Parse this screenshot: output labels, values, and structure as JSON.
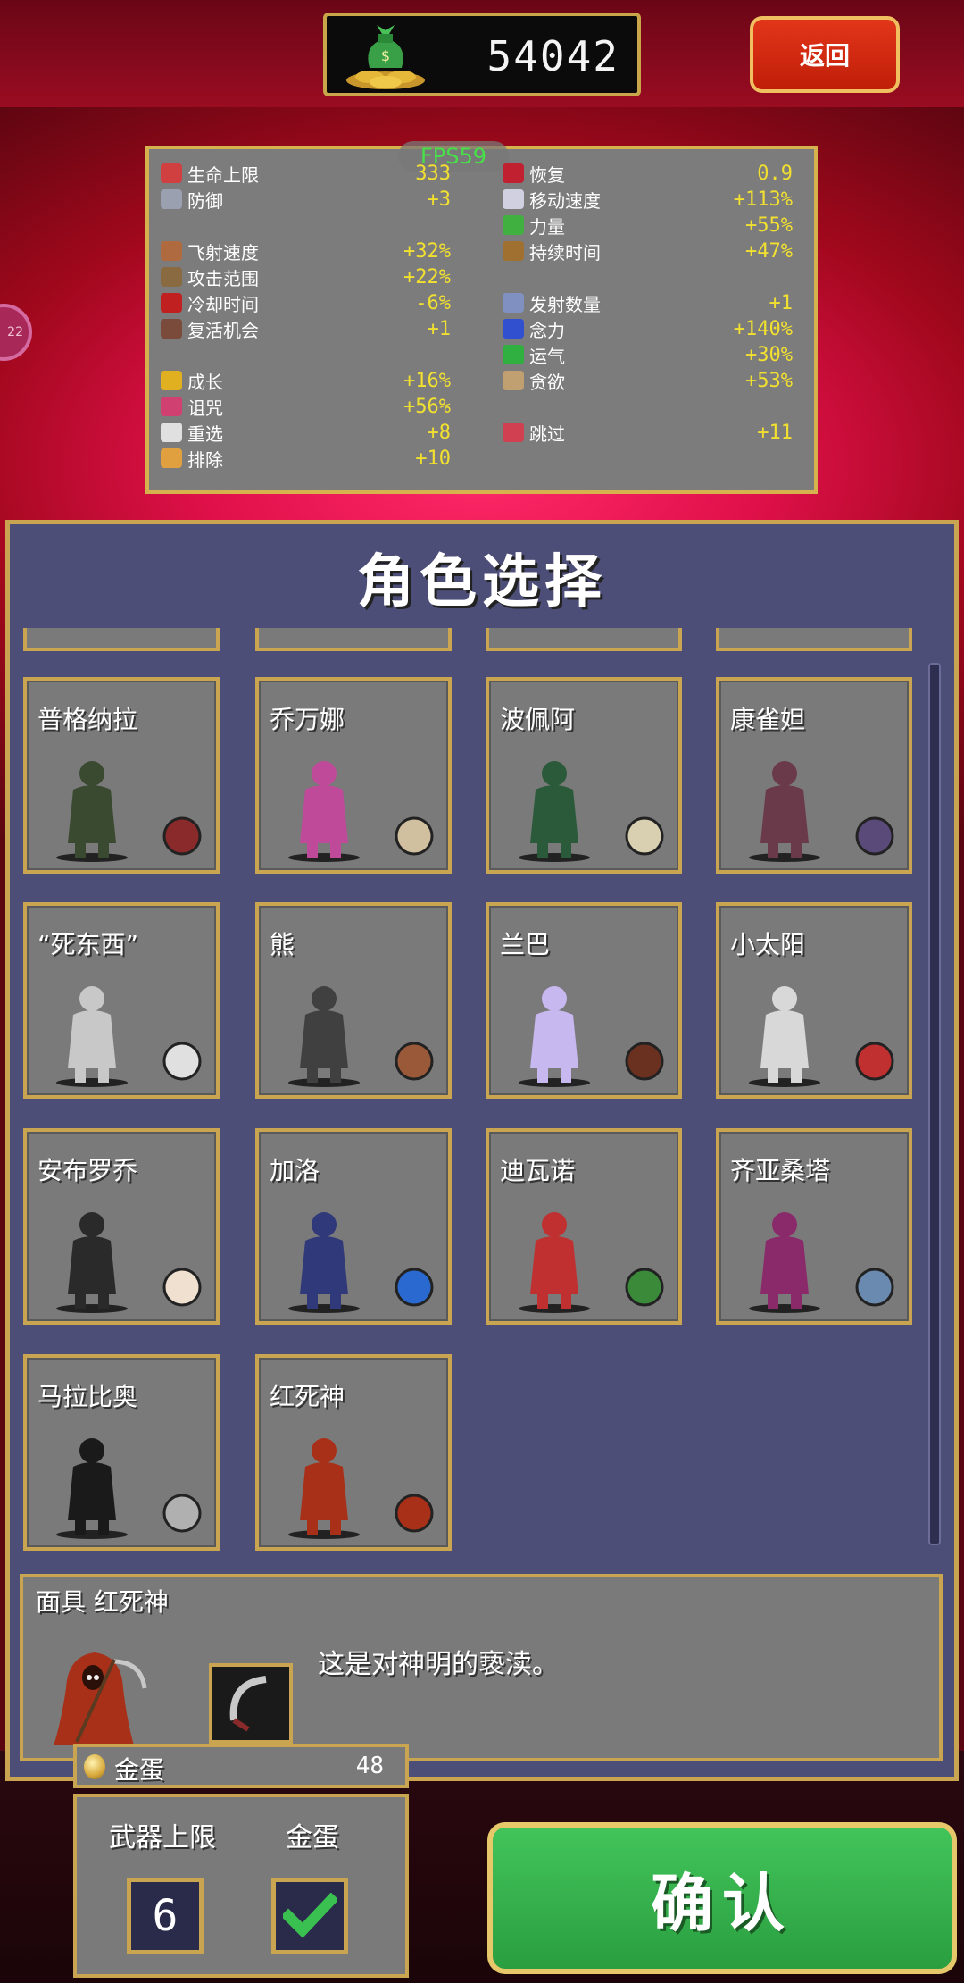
{
  "header": {
    "gold_amount": "54042",
    "back_label": "返回",
    "fps_label": "FPS59",
    "side_badge": "22"
  },
  "stats": {
    "left": [
      {
        "label": "生命上限",
        "value": "333",
        "icon": "heart-icon",
        "color": "#d04040"
      },
      {
        "label": "防御",
        "value": "+3",
        "icon": "armor-icon",
        "color": "#9aa0b0"
      },
      {
        "label": "飞射速度",
        "value": "+32%",
        "icon": "projectile-speed-icon",
        "color": "#b06a40"
      },
      {
        "label": "攻击范围",
        "value": "+22%",
        "icon": "area-icon",
        "color": "#8a6a40"
      },
      {
        "label": "冷却时间",
        "value": "-6%",
        "icon": "cooldown-icon",
        "color": "#c02020"
      },
      {
        "label": "复活机会",
        "value": "+1",
        "icon": "revival-icon",
        "color": "#7a4a3a"
      },
      {
        "label": "成长",
        "value": "+16%",
        "icon": "crown-icon",
        "color": "#e0b020"
      },
      {
        "label": "诅咒",
        "value": "+56%",
        "icon": "skull-icon",
        "color": "#d04070"
      },
      {
        "label": "重选",
        "value": "+8",
        "icon": "dice-icon",
        "color": "#e0e0e0"
      },
      {
        "label": "排除",
        "value": "+10",
        "icon": "hand-icon",
        "color": "#e0a040"
      }
    ],
    "right": [
      {
        "label": "恢复",
        "value": "0.9",
        "icon": "recovery-heart-icon",
        "color": "#c02030"
      },
      {
        "label": "移动速度",
        "value": "+113%",
        "icon": "wing-icon",
        "color": "#d0d0e0"
      },
      {
        "label": "力量",
        "value": "+55%",
        "icon": "leaf-icon",
        "color": "#40b040"
      },
      {
        "label": "持续时间",
        "value": "+47%",
        "icon": "hourglass-icon",
        "color": "#a07030"
      },
      {
        "label": "发射数量",
        "value": "+1",
        "icon": "amount-icon",
        "color": "#8090c0"
      },
      {
        "label": "念力",
        "value": "+140%",
        "icon": "orb-icon",
        "color": "#3050d0"
      },
      {
        "label": "运气",
        "value": "+30%",
        "icon": "clover-icon",
        "color": "#30b040"
      },
      {
        "label": "贪欲",
        "value": "+53%",
        "icon": "greed-icon",
        "color": "#c0a070"
      },
      {
        "label": "跳过",
        "value": "+11",
        "icon": "skip-icon",
        "color": "#d04050"
      }
    ]
  },
  "panel": {
    "title": "角色选择"
  },
  "characters": [
    {
      "name": "普格纳拉",
      "char_color": "#3a4a30",
      "item_color": "#8a2a2a"
    },
    {
      "name": "乔万娜",
      "char_color": "#c04a9a",
      "item_color": "#d0c0a0"
    },
    {
      "name": "波佩阿",
      "char_color": "#2a5a3a",
      "item_color": "#d8d0b0"
    },
    {
      "name": "康雀妲",
      "char_color": "#6a3a4a",
      "item_color": "#5a4a7a"
    },
    {
      "name": "“死东西”",
      "char_color": "#c8c8c8",
      "item_color": "#e0e0e0"
    },
    {
      "name": "熊",
      "char_color": "#404040",
      "item_color": "#9a5a3a"
    },
    {
      "name": "兰巴",
      "char_color": "#c8b8f0",
      "item_color": "#6a3020"
    },
    {
      "name": "小太阳",
      "char_color": "#d8d8d8",
      "item_color": "#c03030"
    },
    {
      "name": "安布罗乔",
      "char_color": "#2a2a2a",
      "item_color": "#f0e0d0"
    },
    {
      "name": "加洛",
      "char_color": "#303a7a",
      "item_color": "#2a6ad0"
    },
    {
      "name": "迪瓦诺",
      "char_color": "#c03030",
      "item_color": "#3a8a3a"
    },
    {
      "name": "齐亚桑塔",
      "char_color": "#8a2a6a",
      "item_color": "#6a8ab0"
    },
    {
      "name": "马拉比奥",
      "char_color": "#1a1a1a",
      "item_color": "#b0b0b0"
    },
    {
      "name": "红死神",
      "char_color": "#a83018",
      "item_color": "#a83018"
    }
  ],
  "detail": {
    "title": "面具  红死神",
    "description": "这是对神明的亵渎。"
  },
  "gold_egg": {
    "label": "金蛋",
    "count": "48"
  },
  "options": {
    "weapon_limit_label": "武器上限",
    "weapon_limit_value": "6",
    "gold_egg_label": "金蛋",
    "gold_egg_checked": true
  },
  "confirm_label": "确认",
  "colors": {
    "panel_bg": "#4c4e78",
    "border_gold": "#c9a552",
    "confirm_green": "#34b04c",
    "back_red": "#d82a10",
    "stat_value_yellow": "#f2e030"
  }
}
